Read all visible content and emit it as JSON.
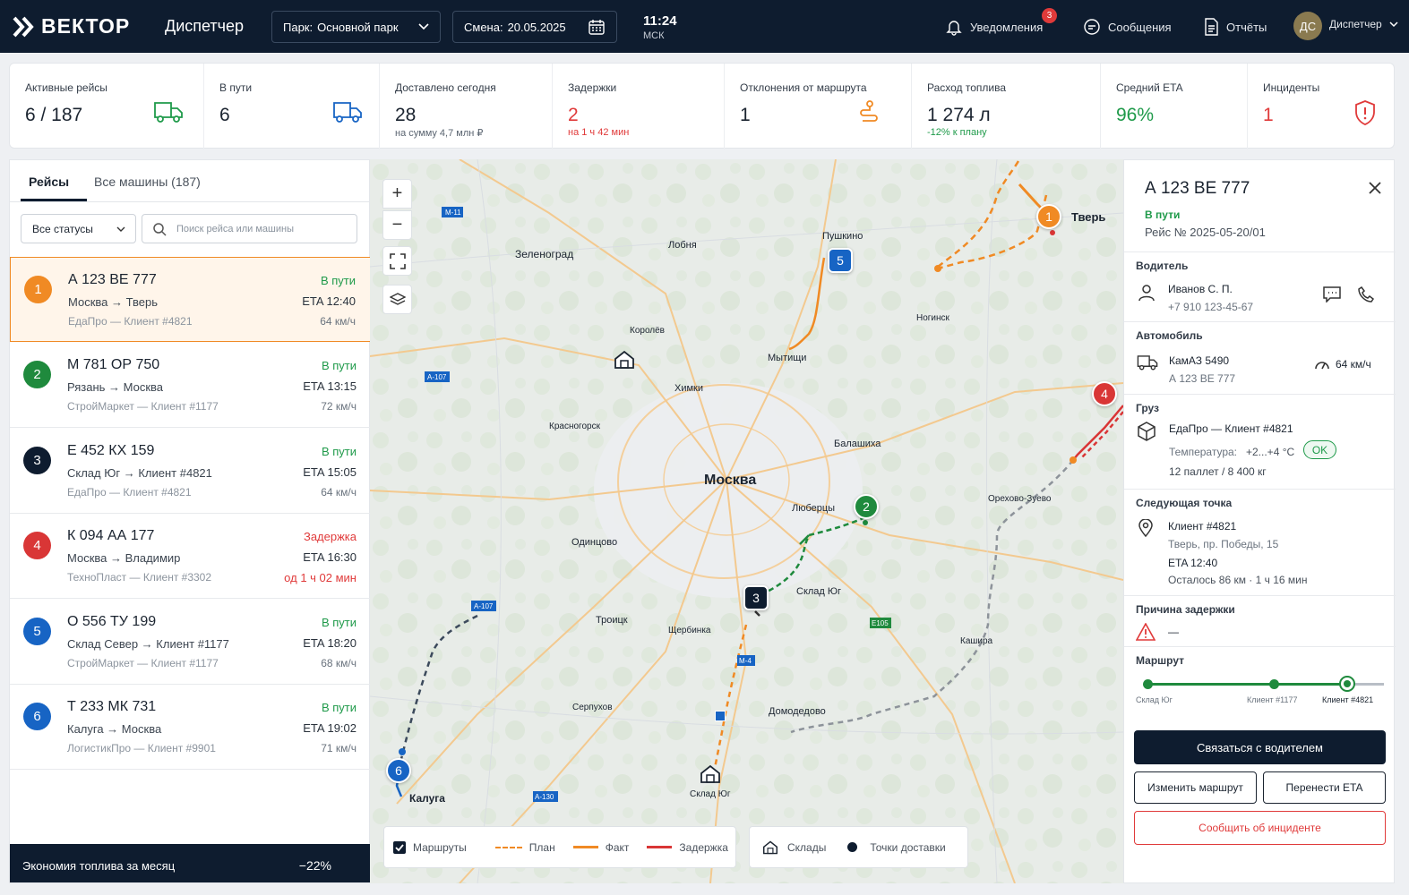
{
  "header": {
    "brand": "ВЕКТОР",
    "app_title": "Диспетчер",
    "park_label": "Парк:",
    "park_value": "Основной парк",
    "shift_label": "Смена:",
    "shift_value": "20.05.2025",
    "time": "11:24",
    "timezone": "МСК",
    "notifications": "Уведомления",
    "notifications_count": "3",
    "messages": "Сообщения",
    "reports": "Отчёты",
    "user_initials": "ДС",
    "user_role": "Диспетчер"
  },
  "kpis": [
    {
      "label": "Активные рейсы",
      "value": "6 / 187",
      "sub": "",
      "icon": "truck-icon",
      "color": "#1b2430"
    },
    {
      "label": "В пути",
      "value": "6",
      "sub": "",
      "icon": "truck-icon",
      "color": "#1b2430"
    },
    {
      "label": "Доставлено сегодня",
      "value": "28",
      "sub": "на сумму 4,7 млн ₽",
      "icon": "",
      "color": "#1b2430"
    },
    {
      "label": "Задержки",
      "value": "2",
      "sub": "на 1 ч 42 мин",
      "icon": "",
      "color": "#e03a3a"
    },
    {
      "label": "Отклонения от маршрута",
      "value": "1",
      "sub": "",
      "icon": "route-icon",
      "color": "#1b2430"
    },
    {
      "label": "Расход топлива",
      "value": "1 274 л",
      "sub": "-12% к плану",
      "icon": "",
      "color": "#1b2430"
    },
    {
      "label": "Средний ETA",
      "value": "96%",
      "sub": "",
      "icon": "",
      "color": "#1f9a4a"
    },
    {
      "label": "Инциденты",
      "value": "1",
      "sub": "",
      "icon": "shield-icon",
      "color": "#e03a3a"
    }
  ],
  "left": {
    "tab_trips": "Рейсы",
    "tab_all": "Все машины (187)",
    "filter": "Все статусы",
    "search_placeholder": "Поиск рейса или машины",
    "trips": [
      {
        "num": "1",
        "color": "#f08a24",
        "plate": "А 123 ВЕ 777",
        "route": "Москва → Тверь",
        "client": "ЕдаПро — Клиент #4821",
        "status": "В пути",
        "status_color": "#1f9a4a",
        "eta": "ETA 12:40",
        "extra": "64 км/ч",
        "extra_color": "#6a737e"
      },
      {
        "num": "2",
        "color": "#1f8a3d",
        "plate": "М 781 ОР 750",
        "route": "Рязань → Москва",
        "client": "СтройМаркет — Клиент #1177",
        "status": "В пути",
        "status_color": "#1f9a4a",
        "eta": "ETA 13:15",
        "extra": "72 км/ч",
        "extra_color": "#6a737e"
      },
      {
        "num": "3",
        "color": "#0e1c2f",
        "plate": "Е 452 КХ 159",
        "route": "Склад Юг → Клиент #4821",
        "client": "ЕдаПро — Клиент #4821",
        "status": "В пути",
        "status_color": "#1f9a4a",
        "eta": "ETA 15:05",
        "extra": "64 км/ч",
        "extra_color": "#6a737e"
      },
      {
        "num": "4",
        "color": "#d93636",
        "plate": "К 094 АА 177",
        "route": "Москва → Владимир",
        "client": "ТехноПласт — Клиент #3302",
        "status": "Задержка",
        "status_color": "#e03a3a",
        "eta": "ETA 16:30",
        "extra": "од 1 ч 02 мин",
        "extra_color": "#e03a3a"
      },
      {
        "num": "5",
        "color": "#1764c4",
        "plate": "О 556 ТУ 199",
        "route": "Склад Север → Клиент #1177",
        "client": "СтройМаркет — Клиент #1177",
        "status": "В пути",
        "status_color": "#1f9a4a",
        "eta": "ETA 18:20",
        "extra": "68 км/ч",
        "extra_color": "#6a737e"
      },
      {
        "num": "6",
        "color": "#1764c4",
        "plate": "Т 233 МК 731",
        "route": "Калуга → Москва",
        "client": "ЛогистикПро — Клиент #9901",
        "status": "В пути",
        "status_color": "#1f9a4a",
        "eta": "ETA 19:02",
        "extra": "71 км/ч",
        "extra_color": "#6a737e"
      }
    ],
    "economy_label": "Экономия топлива за месяц",
    "economy_value": "−22%"
  },
  "map": {
    "cities": [
      {
        "name": "Москва",
        "bold": true
      },
      {
        "name": "Зеленоград"
      },
      {
        "name": "Лобня"
      },
      {
        "name": "Пушкино"
      },
      {
        "name": "Тверь",
        "bold": true
      },
      {
        "name": "Королёв"
      },
      {
        "name": "Мытищи"
      },
      {
        "name": "Химки"
      },
      {
        "name": "Красногорск"
      },
      {
        "name": "Балашиха"
      },
      {
        "name": "Люберцы"
      },
      {
        "name": "Одинцово"
      },
      {
        "name": "Троицк"
      },
      {
        "name": "Щербинка"
      },
      {
        "name": "Склад Юг"
      },
      {
        "name": "Домодедово"
      },
      {
        "name": "Орехово-Зуево"
      },
      {
        "name": "Калуга",
        "bold": true
      },
      {
        "name": "Ногинск"
      },
      {
        "name": "Кашира"
      },
      {
        "name": "Серпухов"
      }
    ],
    "roads": [
      "M-11",
      "A-107",
      "A-107",
      "M-4",
      "E105",
      "A-130"
    ],
    "legend_routes": "Маршруты",
    "legend_plan": "План",
    "legend_fact": "Факт",
    "legend_delay": "Задержка",
    "legend_warehouses": "Склады",
    "legend_points": "Точки доставки"
  },
  "details": {
    "plate": "А 123 ВЕ 777",
    "status": "В пути",
    "trip_no": "Рейс № 2025-05-20/01",
    "driver_label": "Водитель",
    "driver_name": "Иванов С. П.",
    "driver_phone": "+7 910 123-45-67",
    "vehicle_label": "Автомобиль",
    "vehicle_model": "КамАЗ 5490",
    "vehicle_plate": "А 123 ВЕ 777",
    "vehicle_speed": "64 км/ч",
    "cargo_label": "Груз",
    "cargo_client": "ЕдаПро — Клиент #4821",
    "cargo_temp_label": "Температура:",
    "cargo_temp": "+2...+4 °C",
    "cargo_ok": "OK",
    "cargo_load": "12 паллет / 8 400 кг",
    "next_label": "Следующая точка",
    "next_client": "Клиент #4821",
    "next_address": "Тверь, пр. Победы, 15",
    "next_eta": "ETA 12:40",
    "next_remaining": "Осталось 86 км · 1 ч 16 мин",
    "delay_label": "Причина задержки",
    "delay_value": "—",
    "route_label": "Маршрут",
    "route_points": [
      "Склад Юг",
      "Клиент #1177",
      "Клиент #4821"
    ],
    "btn_contact": "Связаться с водителем",
    "btn_change": "Изменить маршрут",
    "btn_eta": "Перенести ETA",
    "btn_incident": "Сообщить об инциденте"
  }
}
